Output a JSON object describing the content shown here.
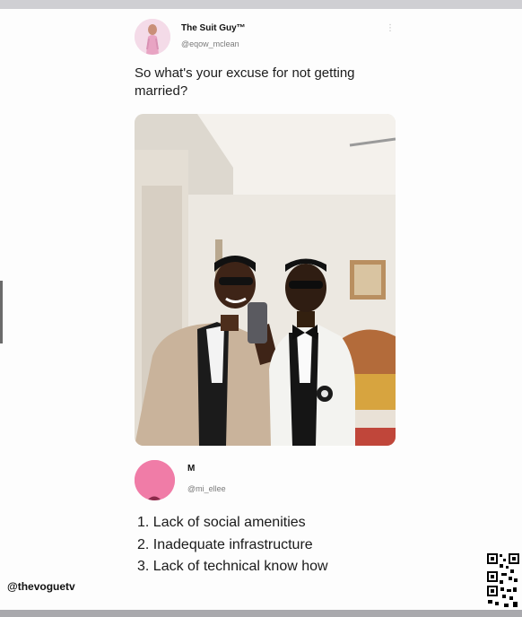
{
  "tweet": {
    "author_name": "The Suit Guy™",
    "author_handle": "@eqow_mclean",
    "text": "So what's your excuse for not getting married?"
  },
  "reply": {
    "author_name": "M",
    "author_handle": "@mi_ellee",
    "items": [
      "1. Lack of social amenities",
      "2. Inadequate infrastructure",
      "3. Lack of technical know how"
    ]
  },
  "watermark": "@thevoguetv",
  "icons": {
    "more_menu": "more-dots-icon",
    "qr": "qr-code-icon"
  }
}
